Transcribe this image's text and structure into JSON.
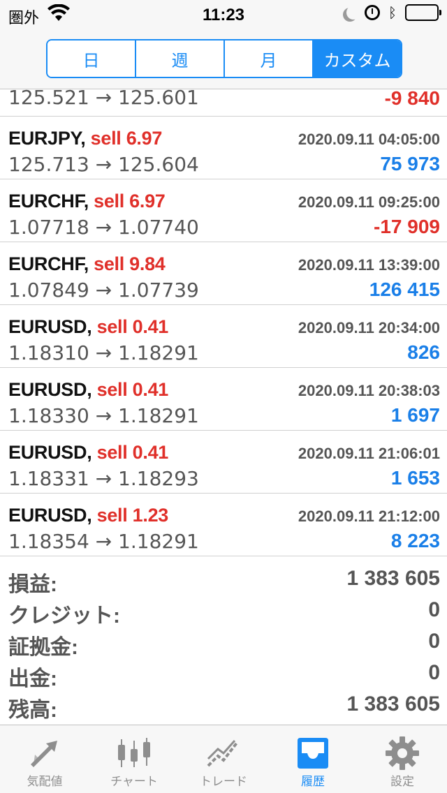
{
  "status_bar": {
    "carrier": "圏外",
    "time": "11:23"
  },
  "segments": [
    "日",
    "週",
    "月",
    "カスタム"
  ],
  "partial_row": {
    "prices": "125.521 → 125.601",
    "profit": "-9 840"
  },
  "trades": [
    {
      "symbol": "EURJPY,",
      "side": "sell 6.97",
      "time": "2020.09.11 04:05:00",
      "prices": "125.713 → 125.604",
      "profit": "75 973",
      "sign": "pos"
    },
    {
      "symbol": "EURCHF,",
      "side": "sell 6.97",
      "time": "2020.09.11 09:25:00",
      "prices": "1.07718 → 1.07740",
      "profit": "-17 909",
      "sign": "neg"
    },
    {
      "symbol": "EURCHF,",
      "side": "sell 9.84",
      "time": "2020.09.11 13:39:00",
      "prices": "1.07849 → 1.07739",
      "profit": "126 415",
      "sign": "pos"
    },
    {
      "symbol": "EURUSD,",
      "side": "sell 0.41",
      "time": "2020.09.11 20:34:00",
      "prices": "1.18310 → 1.18291",
      "profit": "826",
      "sign": "pos"
    },
    {
      "symbol": "EURUSD,",
      "side": "sell 0.41",
      "time": "2020.09.11 20:38:03",
      "prices": "1.18330 → 1.18291",
      "profit": "1 697",
      "sign": "pos"
    },
    {
      "symbol": "EURUSD,",
      "side": "sell 0.41",
      "time": "2020.09.11 21:06:01",
      "prices": "1.18331 → 1.18293",
      "profit": "1 653",
      "sign": "pos"
    },
    {
      "symbol": "EURUSD,",
      "side": "sell 1.23",
      "time": "2020.09.11 21:12:00",
      "prices": "1.18354 → 1.18291",
      "profit": "8 223",
      "sign": "pos"
    }
  ],
  "summary": [
    {
      "label": "損益:",
      "value": "1 383 605"
    },
    {
      "label": "クレジット:",
      "value": "0"
    },
    {
      "label": "証拠金:",
      "value": "0"
    },
    {
      "label": "出金:",
      "value": "0"
    },
    {
      "label": "残高:",
      "value": "1 383 605"
    }
  ],
  "tabs": [
    {
      "label": "気配値",
      "icon": "quotes-arrows-icon",
      "active": false
    },
    {
      "label": "チャート",
      "icon": "chart-candles-icon",
      "active": false
    },
    {
      "label": "トレード",
      "icon": "trade-line-icon",
      "active": false
    },
    {
      "label": "履歴",
      "icon": "history-inbox-icon",
      "active": true
    },
    {
      "label": "設定",
      "icon": "settings-gear-icon",
      "active": false
    }
  ],
  "colors": {
    "accent": "#1a8cf5",
    "loss": "#e0302a",
    "profit": "#1a7fe8"
  }
}
